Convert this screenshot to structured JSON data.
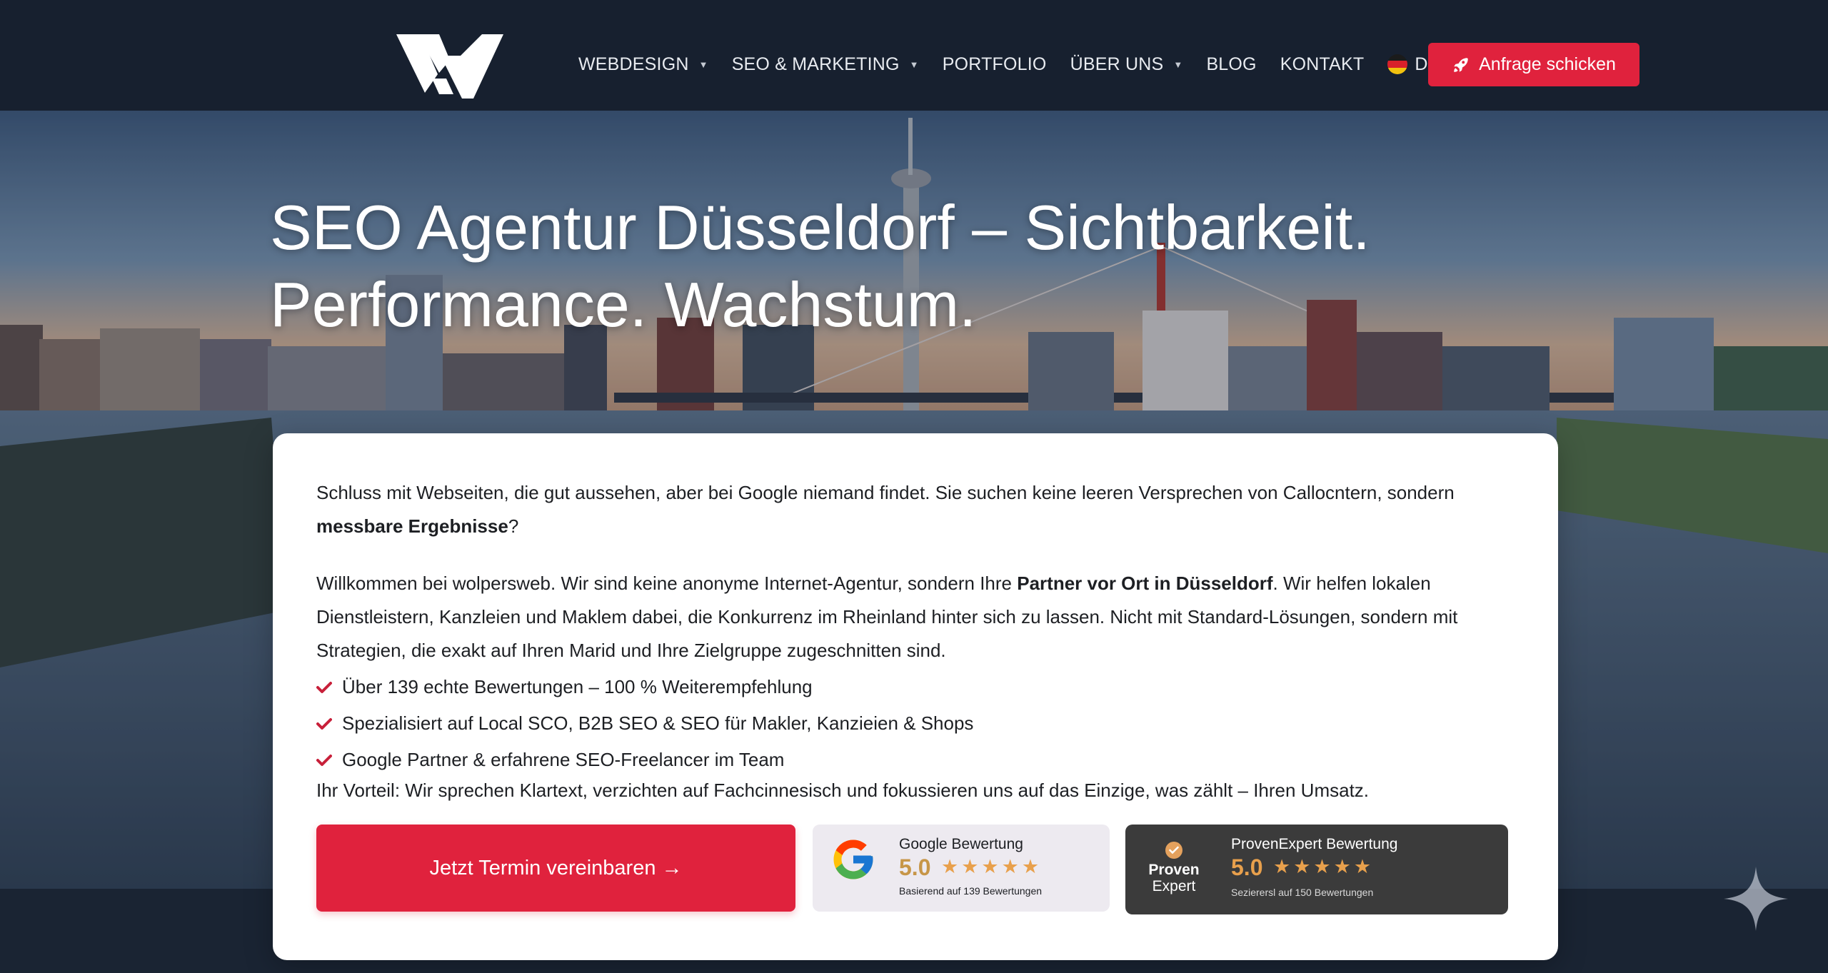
{
  "header": {
    "logo_label": "wolpersweb logo",
    "nav": [
      {
        "label": "WEBDESIGN",
        "dropdown": true
      },
      {
        "label": "SEO & MARKETING",
        "dropdown": true
      },
      {
        "label": "PORTFOLIO",
        "dropdown": false
      },
      {
        "label": "ÜBER UNS",
        "dropdown": true
      },
      {
        "label": "BLOG",
        "dropdown": false
      },
      {
        "label": "KONTAKT",
        "dropdown": false
      }
    ],
    "language": {
      "label": "DE",
      "flag_icon": "germany-flag-icon"
    },
    "cta": {
      "label": "Anfrage schicken",
      "icon": "rocket-icon"
    }
  },
  "hero": {
    "title_line1": "SEO Agentur Düsseldorf – Sichtbarkeit.",
    "title_line2": "Performance. Wachstum."
  },
  "card": {
    "p1_text": "Schluss mit Webseiten, die gut aussehen, aber bei Google niemand findet. Sie suchen keine leeren Versprechen von Callocntern, sondern ",
    "p1_bold": "messbare Ergebnisse",
    "p1_end": "?",
    "p2_text": "Willkommen bei wolpersweb. Wir sind keine anonyme Internet-Agentur, sondern Ihre ",
    "p2_bold": "Partner vor Ort in Düsseldorf",
    "p2_end": ". Wir helfen lokalen Dienstleistern, Kanzleien und Maklem dabei, die Konkurrenz im Rheinland hinter sich zu lassen. Nicht mit Standard-Lösungen, sondern mit Strategien, die exakt auf Ihren Marid und Ihre Zielgruppe zugeschnitten sind.",
    "checks": [
      "Über 139 echte Bewertungen – 100 % Weiterempfehlung",
      "Spezialisiert auf Local SCO, B2B SEO & SEO für Makler, Kanzieien & Shops",
      "Google Partner & erfahrene SEO-Freelancer im Team"
    ],
    "p3_text": "Ihr Vorteil: Wir sprechen Klartext, verzichten auf Fachcinnesisch und fokussieren uns auf das Einzige, was zählt – Ihren Umsatz.",
    "cta_label": "Jetzt Termin vereinbaren →",
    "google_badge": {
      "title": "Google Bewertung",
      "score": "5.0",
      "stars": "★★★★★",
      "sub": "Basierend auf 139 Bewertungen"
    },
    "pe_badge": {
      "logo_line1": "Proven",
      "logo_line2": "Expert",
      "title": "ProvenExpert Bewertung",
      "score": "5.0",
      "stars": "★★★★★",
      "sub": "Sezierersl auf 150 Bewertungen"
    }
  },
  "colors": {
    "header_bg": "#17202f",
    "accent_red": "#e0223d",
    "star_gold": "#e8a04c",
    "card_bg": "#ffffff"
  }
}
